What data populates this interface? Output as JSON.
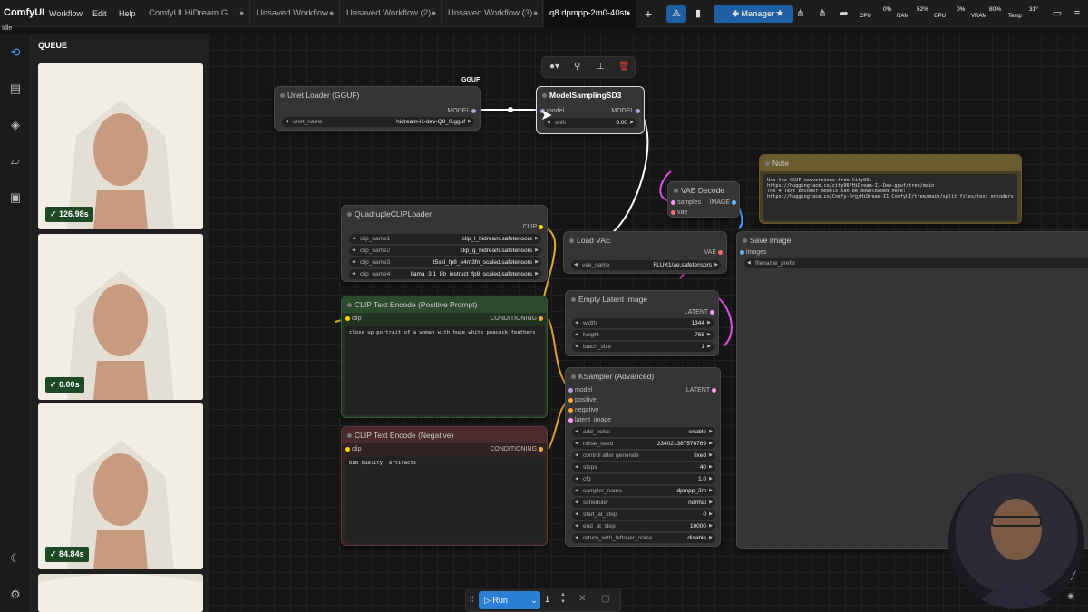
{
  "app": {
    "name": "ComfyUI",
    "status": "Idle"
  },
  "menu": [
    "Workflow",
    "Edit",
    "Help"
  ],
  "tabs": [
    {
      "label": "ComfyUI HiDream G...",
      "mark": "●"
    },
    {
      "label": "Unsaved Workflow",
      "mark": "●"
    },
    {
      "label": "Unsaved Workflow (2)",
      "mark": "●"
    },
    {
      "label": "Unsaved Workflow (3)",
      "mark": "●"
    },
    {
      "label": "q8 dpmpp-2m0-40st",
      "mark": "●"
    }
  ],
  "toolbar": {
    "add": "+",
    "manager": "Manager"
  },
  "monitor": {
    "cpu_label": "CPU",
    "cpu": "0%",
    "ram_label": "RAM",
    "ram": "52%",
    "gpu_label": "GPU",
    "gpu": "0%",
    "vram_label": "VRAM",
    "vram": "80%",
    "temp_label": "Temp",
    "temp": "31°"
  },
  "monitor_levels": {
    "cpu": 0.0,
    "ram": 0.52,
    "gpu": 0.0,
    "vram": 0.8,
    "temp": 0.31
  },
  "queue": {
    "title": "QUEUE",
    "items": [
      {
        "time": "126.98s"
      },
      {
        "time": "0.00s"
      },
      {
        "time": "84.84s"
      },
      {
        "time": ""
      }
    ]
  },
  "nodes": {
    "gguf_label": "GGUF",
    "unet": {
      "title": "Unet Loader (GGUF)",
      "out": "MODEL",
      "w_name": "unet_name",
      "w_value": "hidream-i1-dev-Q8_0.gguf"
    },
    "msd3": {
      "title": "ModelSamplingSD3",
      "in": "model",
      "out": "MODEL",
      "w_name": "shift",
      "w_value": "9.00"
    },
    "quad": {
      "title": "QuadrupleCLIPLoader",
      "out": "CLIP",
      "widgets": [
        {
          "name": "clip_name1",
          "value": "clip_l_hidream.safetensors"
        },
        {
          "name": "clip_name2",
          "value": "clip_g_hidream.safetensors"
        },
        {
          "name": "clip_name3",
          "value": "t5xxl_fp8_e4m3fn_scaled.safetensors"
        },
        {
          "name": "clip_name4",
          "value": "llama_3.1_8b_instruct_fp8_scaled.safetensors"
        }
      ]
    },
    "pos": {
      "title": "CLIP Text Encode (Positive Prompt)",
      "in": "clip",
      "out": "CONDITIONING",
      "text": "close up portrait of a woman with huge white peacock feathers"
    },
    "neg": {
      "title": "CLIP Text Encode (Negative)",
      "in": "clip",
      "out": "CONDITIONING",
      "text": "bad quality, artifacts"
    },
    "loadvae": {
      "title": "Load VAE",
      "out": "VAE",
      "w_name": "vae_name",
      "w_value": "FLUX1/ae.safetensors"
    },
    "vaedecode": {
      "title": "VAE Decode",
      "in1": "samples",
      "in2": "vae",
      "out": "IMAGE"
    },
    "latent": {
      "title": "Empty Latent Image",
      "out": "LATENT",
      "widgets": [
        {
          "name": "width",
          "value": "1344"
        },
        {
          "name": "height",
          "value": "768"
        },
        {
          "name": "batch_size",
          "value": "1"
        }
      ]
    },
    "ksampler": {
      "title": "KSampler (Advanced)",
      "out": "LATENT",
      "inputs": [
        "model",
        "positive",
        "negative",
        "latent_image"
      ],
      "widgets": [
        {
          "name": "add_noise",
          "value": "enable"
        },
        {
          "name": "noise_seed",
          "value": "234021387576769"
        },
        {
          "name": "control after generate",
          "value": "fixed"
        },
        {
          "name": "steps",
          "value": "40"
        },
        {
          "name": "cfg",
          "value": "1.0"
        },
        {
          "name": "sampler_name",
          "value": "dpmpp_2m"
        },
        {
          "name": "scheduler",
          "value": "normal"
        },
        {
          "name": "start_at_step",
          "value": "0"
        },
        {
          "name": "end_at_step",
          "value": "10000"
        },
        {
          "name": "return_with_leftover_noise",
          "value": "disable"
        }
      ]
    },
    "note": {
      "title": "Note",
      "lines": [
        "Use the GGUF conversions from City96:",
        "",
        "https://huggingface.co/city96/HiDream-I1-Dev-gguf/tree/main",
        "",
        "The 4 Text Encoder models can be downloaded here:",
        "",
        "https://huggingface.co/Comfy-Org/HiDream-I1_ComfyUI/tree/main/split_files/text_encoders"
      ]
    },
    "save": {
      "title": "Save Image",
      "in": "images",
      "w_name": "filename_prefix"
    }
  },
  "runbar": {
    "run": "Run",
    "count": "1"
  },
  "colors": {
    "accent": "#2a7fd4",
    "green_node": "#2c4a2c",
    "red_node": "#4a2a2a",
    "note": "#6a5a2e"
  }
}
